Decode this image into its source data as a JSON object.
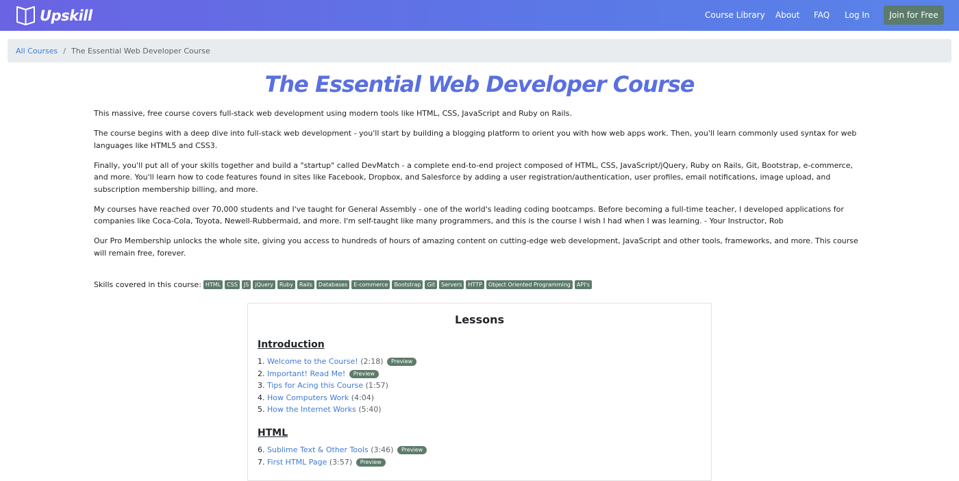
{
  "nav": {
    "brand": "Upskill",
    "links": [
      "Course Library",
      "About",
      "FAQ",
      "Log In"
    ],
    "join_label": "Join for Free"
  },
  "breadcrumb": {
    "root": "All Courses",
    "separator": "/",
    "current": "The Essential Web Developer Course"
  },
  "course": {
    "title": "The Essential Web Developer Course",
    "paragraphs": [
      "This massive, free course covers full-stack web development using modern tools like HTML, CSS, JavaScript and Ruby on Rails.",
      "The course begins with a deep dive into full-stack web development - you'll start by building a blogging platform to orient you with how web apps work. Then, you'll learn commonly used syntax for web languages like HTML5 and CSS3.",
      "Finally, you'll put all of your skills together and build a \"startup\" called DevMatch - a complete end-to-end project composed of HTML, CSS, JavaScript/jQuery, Ruby on Rails, Git, Bootstrap, e-commerce, and more. You'll learn how to code features found in sites like Facebook, Dropbox, and Salesforce by adding a user registration/authentication, user profiles, email notifications, image upload, and subscription membership billing, and more.",
      "My courses have reached over 70,000 students and I've taught for General Assembly - one of the world's leading coding bootcamps. Before becoming a full-time teacher, I developed applications for companies like Coca-Cola, Toyota, Newell-Rubbermaid, and more. I'm self-taught like many programmers, and this is the course I wish I had when I was learning. - Your Instructor, Rob",
      "Our Pro Membership unlocks the whole site, giving you access to hundreds of hours of amazing content on cutting-edge web development, JavaScript and other tools, frameworks, and more. This course will remain free, forever."
    ]
  },
  "skills": {
    "label": "Skills covered in this course:",
    "items": [
      "HTML",
      "CSS",
      "JS",
      "jQuery",
      "Ruby",
      "Rails",
      "Databases",
      "E-commerce",
      "Bootstrap",
      "Git",
      "Servers",
      "HTTP",
      "Object Oriented Programming",
      "API's"
    ]
  },
  "lessons": {
    "heading": "Lessons",
    "preview_label": "Preview",
    "sections": [
      {
        "title": "Introduction",
        "items": [
          {
            "num": "1.",
            "title": "Welcome to the Course!",
            "duration": "(2:18)",
            "preview": true
          },
          {
            "num": "2.",
            "title": "Important! Read Me!",
            "duration": "",
            "preview": true
          },
          {
            "num": "3.",
            "title": "Tips for Acing this Course",
            "duration": "(1:57)",
            "preview": false
          },
          {
            "num": "4.",
            "title": "How Computers Work",
            "duration": "(4:04)",
            "preview": false
          },
          {
            "num": "5.",
            "title": "How the Internet Works",
            "duration": "(5:40)",
            "preview": false
          }
        ]
      },
      {
        "title": "HTML",
        "items": [
          {
            "num": "6.",
            "title": "Sublime Text & Other Tools",
            "duration": "(3:46)",
            "preview": true
          },
          {
            "num": "7.",
            "title": "First HTML Page",
            "duration": "(3:57)",
            "preview": true
          }
        ]
      }
    ]
  },
  "colors": {
    "nav_gradient_start": "#6a63e3",
    "nav_gradient_end": "#5a84e8",
    "title": "#5a6fe0",
    "link": "#3f7ad4",
    "badge": "#5d7b6a"
  }
}
